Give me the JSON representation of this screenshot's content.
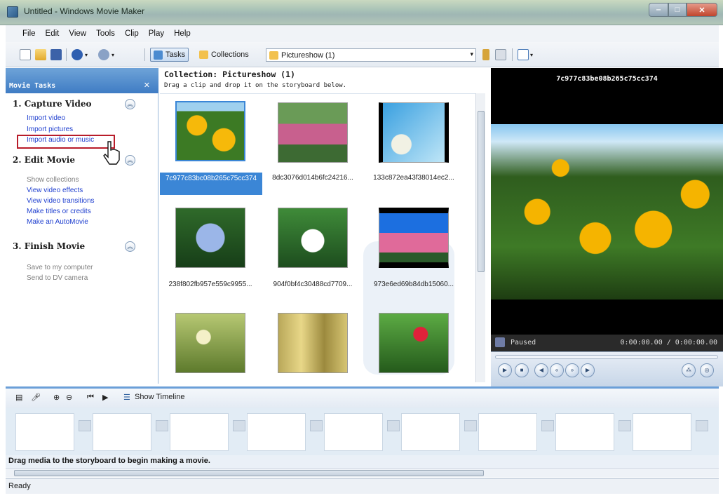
{
  "window": {
    "title": "Untitled - Windows Movie Maker"
  },
  "menu": [
    "File",
    "Edit",
    "View",
    "Tools",
    "Clip",
    "Play",
    "Help"
  ],
  "toolbar": {
    "tasks_label": "Tasks",
    "collections_label": "Collections",
    "collection_combo_value": "Pictureshow (1)"
  },
  "tasks": {
    "header": "Movie Tasks",
    "sections": [
      {
        "title": "1. Capture Video",
        "links": [
          "Import video",
          "Import pictures",
          "Import audio or music"
        ]
      },
      {
        "title": "2. Edit Movie",
        "links": [
          "Show collections",
          "View video effects",
          "View video transitions",
          "Make titles or credits",
          "Make an AutoMovie"
        ]
      },
      {
        "title": "3. Finish Movie",
        "links": [
          "Save to my computer",
          "Send to DV camera"
        ]
      }
    ],
    "highlighted_link": "Import audio or music"
  },
  "collection": {
    "title": "Collection: Pictureshow (1)",
    "hint": "Drag a clip and drop it on the storyboard below.",
    "items": [
      {
        "caption": "7c977c83bc08b265c75cc374",
        "selected": true
      },
      {
        "caption": "8dc3076d014b6fc24216..."
      },
      {
        "caption": "133c872ea43f38014ec2..."
      },
      {
        "caption": "238f802fb957e559c9955..."
      },
      {
        "caption": "904f0bf4c30488cd7709..."
      },
      {
        "caption": "973e6ed69b84db15060..."
      },
      {
        "caption": ""
      },
      {
        "caption": ""
      },
      {
        "caption": ""
      }
    ]
  },
  "preview": {
    "clip_name": "7c977c83be08b265c75cc374",
    "state": "Paused",
    "time": "0:00:00.00 / 0:00:00.00"
  },
  "storyboard": {
    "show_timeline_label": "Show Timeline",
    "message": "Drag media to the storyboard to begin making a movie."
  },
  "status": {
    "text": "Ready"
  },
  "colors": {
    "accent": "#3b86d6",
    "highlight_box": "#b81c2a",
    "link": "#1f3fcf"
  }
}
